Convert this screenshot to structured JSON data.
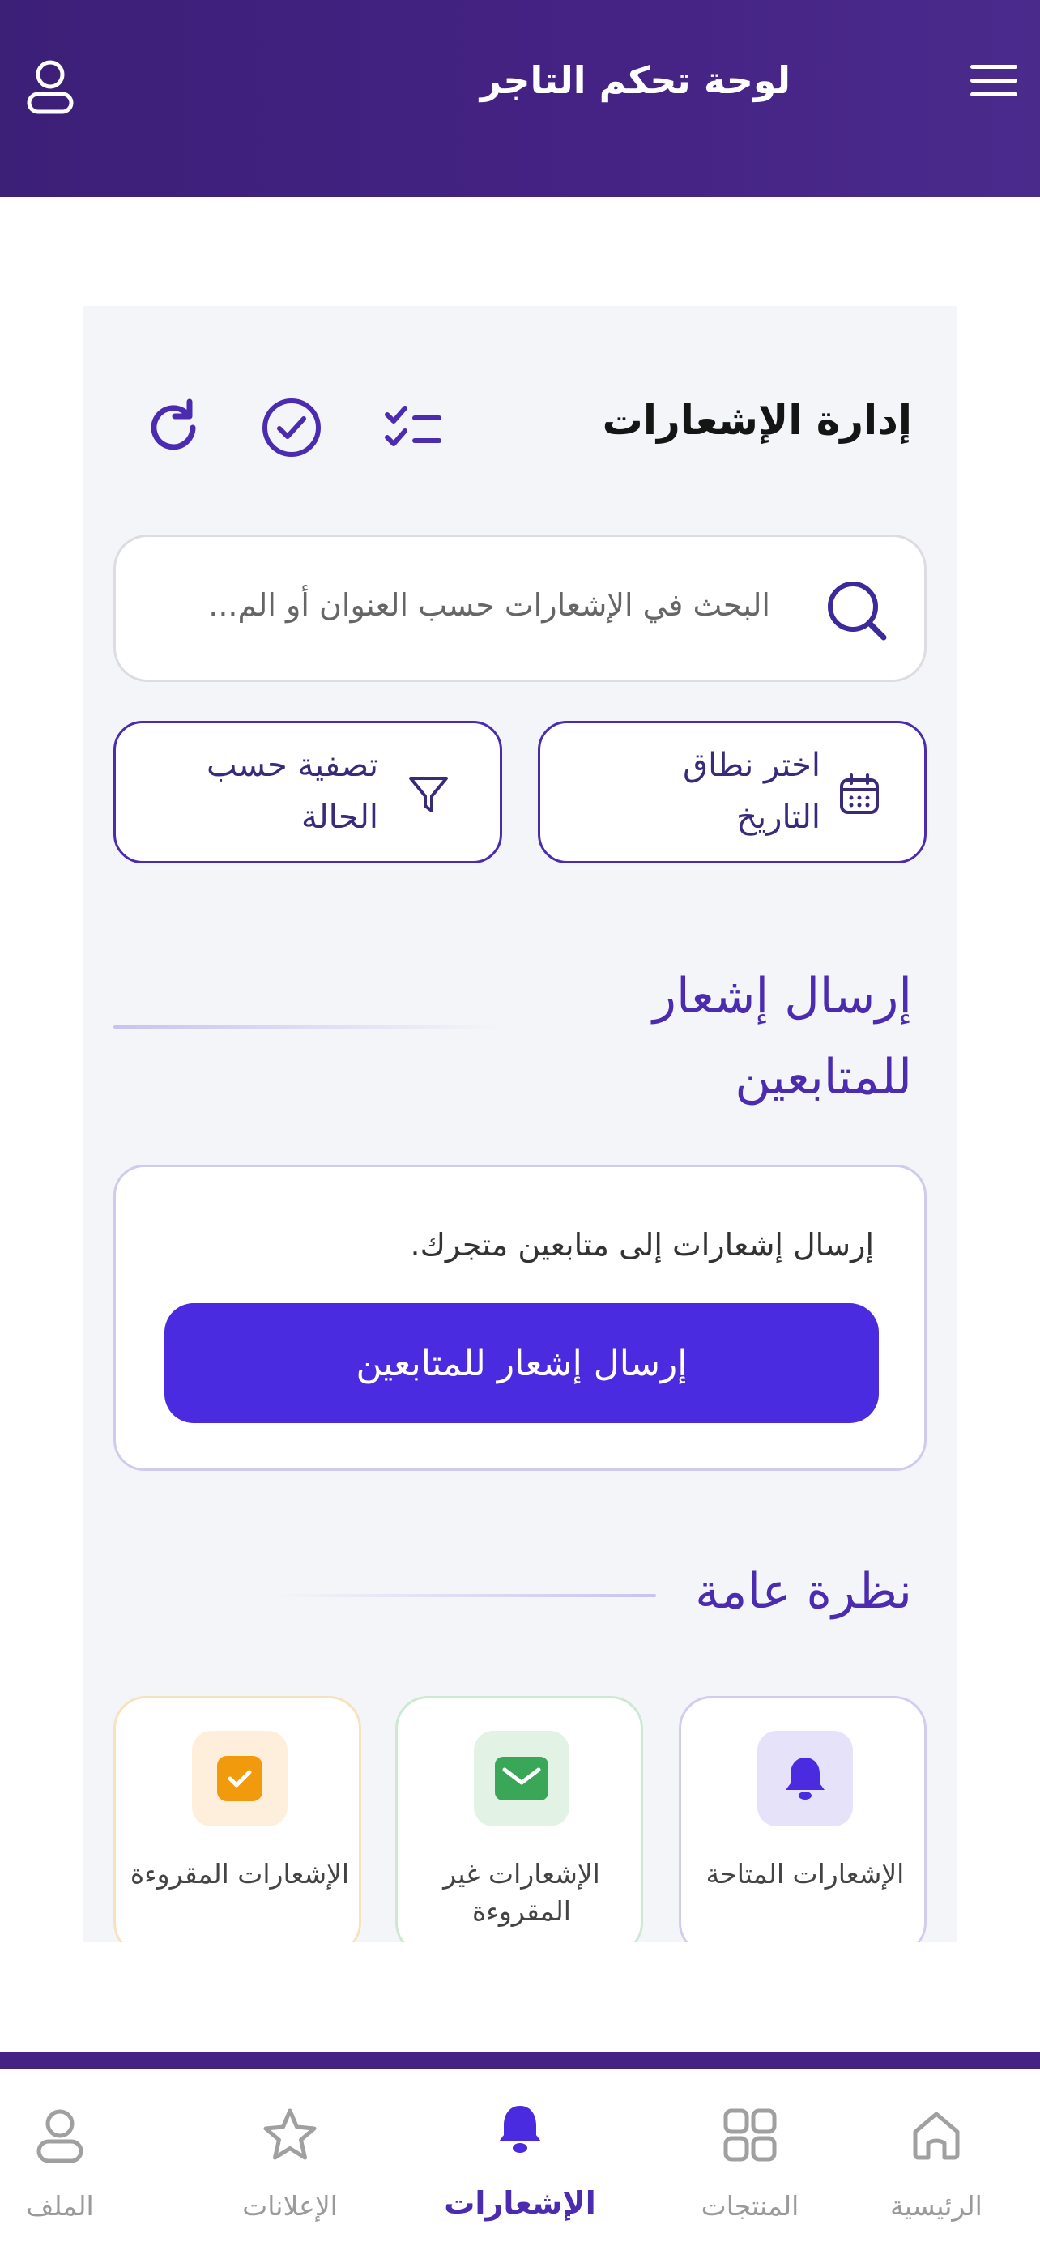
{
  "header": {
    "title": "لوحة تحكم التاجر",
    "menu_icon": "menu-icon",
    "user_icon": "user-icon"
  },
  "colors": {
    "primary": "#4a2bdf",
    "header_bg": "#452385",
    "panel_bg": "#f4f5f8",
    "success": "#3aa657",
    "warning": "#f29a0d"
  },
  "notifications": {
    "title": "إدارة الإشعارات",
    "search": {
      "placeholder": "البحث في الإشعارات حسب العنوان أو الم..."
    },
    "date_filter": {
      "label": "اختر نطاق التاريخ"
    },
    "status_filter": {
      "label": "تصفية حسب الحالة"
    }
  },
  "send_section": {
    "title": "إرسال إشعار للمتابعين",
    "description": "إرسال إشعارات إلى متابعين متجرك.",
    "button_label": "إرسال إشعار للمتابعين"
  },
  "overview": {
    "title": "نظرة عامة",
    "stats": [
      {
        "label": "الإشعارات المتاحة",
        "icon": "bell-icon"
      },
      {
        "label": "الإشعارات غير المقروءة",
        "icon": "envelope-icon"
      },
      {
        "label": "الإشعارات المقروءة",
        "icon": "check-icon"
      }
    ]
  },
  "bottom_nav": {
    "items": [
      {
        "label": "الرئيسية",
        "icon": "home-icon",
        "active": false
      },
      {
        "label": "المنتجات",
        "icon": "grid-icon",
        "active": false
      },
      {
        "label": "الإشعارات",
        "icon": "bell-icon",
        "active": true
      },
      {
        "label": "الإعلانات",
        "icon": "star-icon",
        "active": false
      },
      {
        "label": "الملف",
        "icon": "user-icon",
        "active": false
      }
    ]
  }
}
